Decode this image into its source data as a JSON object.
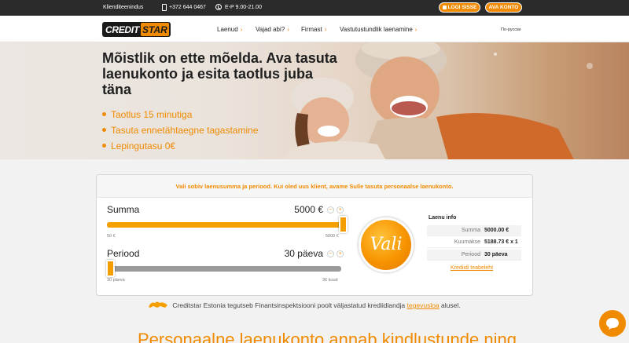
{
  "topbar": {
    "customer_service": "Klienditeenindus",
    "phone": "+372 644 0467",
    "hours": "E-P 9.00-21.00",
    "login_label": "LOGI SISSE",
    "open_account_label": "AVA KONTO"
  },
  "nav": {
    "logo_credit": "CREDIT",
    "logo_star": "STAR",
    "items": [
      {
        "label": "Laenud"
      },
      {
        "label": "Vajad abi?"
      },
      {
        "label": "Firmast"
      },
      {
        "label": "Vastutustundlik laenamine"
      }
    ],
    "language": "По-русски"
  },
  "hero": {
    "headline": "Mõistlik on ette mõelda. Ava tasuta laenukonto ja esita taotlus juba täna",
    "bullets": [
      "Taotlus 15 minutiga",
      "Tasuta ennetähtaegne tagastamine",
      "Lepingutasu 0€"
    ]
  },
  "calculator": {
    "intro": "Vali sobiv laenusumma ja periood. Kui oled uus klient, avame Sulle tasuta personaalse laenukonto.",
    "sum": {
      "label": "Summa",
      "value": "5000 €",
      "min_label": "50 €",
      "max_label": "5000 €",
      "min": 50,
      "max": 5000,
      "current": 5000
    },
    "period": {
      "label": "Periood",
      "value": "30 päeva",
      "min_label": "30 päeva",
      "max_label": "36 kuud",
      "fill_fraction": 0
    },
    "plus": "+",
    "minus": "−",
    "submit_label": "Vali",
    "info": {
      "title": "Laenu info",
      "rows": [
        {
          "key": "Summa",
          "value": "5000.00 €"
        },
        {
          "key": "Kuumakse",
          "value": "5188.73 € x 1"
        },
        {
          "key": "Periood",
          "value": "30 päeva"
        }
      ],
      "link": "Krediidi teabeleht"
    }
  },
  "note": {
    "text": "Creditstar Estonia tegutseb Finantsinspektsiooni poolt väljastatud krediidiandja",
    "link": "tegevusloa",
    "suffix": "alusel."
  },
  "bottom_headline": "Personaalne laenukonto annab kindlustunde ning",
  "colors": {
    "accent": "#f08a00",
    "topbar": "#2b2b2b",
    "slider_track_grey": "#9a9a9a"
  },
  "icons": [
    "phone-icon",
    "clock-icon",
    "lock-icon",
    "chevron-down-icon",
    "chat-icon",
    "lion-icon"
  ]
}
